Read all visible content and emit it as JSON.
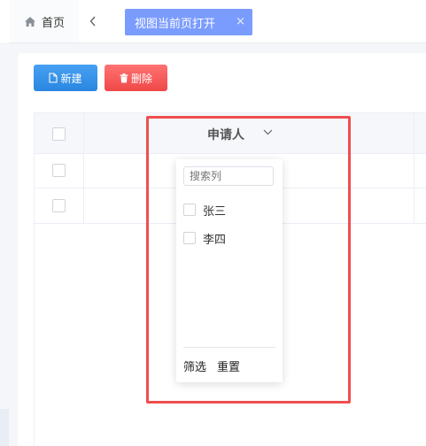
{
  "tabs": {
    "home_label": "首页",
    "active_label": "视图当前页打开",
    "close_glyph": "×",
    "back_glyph": "‹"
  },
  "toolbar": {
    "new_label": "新建",
    "delete_label": "删除"
  },
  "table": {
    "column_header": "申请人",
    "rows": [
      "",
      ""
    ]
  },
  "filter": {
    "search_placeholder": "搜索列",
    "options": [
      "张三",
      "李四"
    ],
    "filter_button": "筛选",
    "reset_button": "重置"
  },
  "colors": {
    "primary": "#2a86e0",
    "danger": "#f04848",
    "tab_active": "#7b9cff",
    "highlight": "#ee4f4f"
  },
  "icons": {
    "home": "home-icon",
    "back": "chevron-left-icon",
    "close": "close-icon",
    "new": "document-icon",
    "delete": "trash-icon",
    "sort": "chevron-down-icon"
  }
}
